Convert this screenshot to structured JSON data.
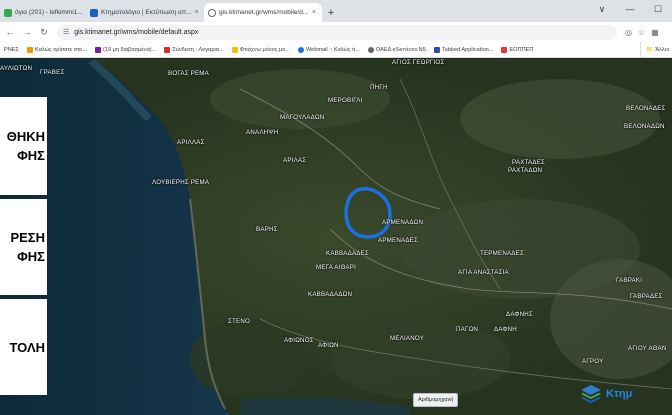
{
  "browser": {
    "tabs": [
      {
        "title": "όγια (201) - lefkimmi1...",
        "close": "×"
      },
      {
        "title": "Κτηματολόγιο | Εκτύπωση απ...",
        "close": "×"
      },
      {
        "title": "gis.ktimanet.gr/wms/mobile/d...",
        "close": "×"
      }
    ],
    "new_tab": "+",
    "window_controls": [
      "∨",
      "—",
      "☐"
    ],
    "url": "gis.ktimanet.gr/wms/mobile/default.aspx",
    "bookmarks": [
      {
        "label": "ΡΝΕΣ",
        "color": "#ffffff"
      },
      {
        "label": "Καλώς ορίσατε στο...",
        "color": "#f29900"
      },
      {
        "label": "(19 μη διαβασμένα)...",
        "color": "#7b1fa2"
      },
      {
        "label": "Σύνδεση - Λογαρια...",
        "color": "#d93025"
      },
      {
        "label": "Φτιάχνω μόνος μο...",
        "color": "#fbbc04"
      },
      {
        "label": "Webmail :: Καλώς ή...",
        "color": "#1a73e8"
      },
      {
        "label": "ΟΑΕΔ eServices Ν5",
        "color": "#5f6368"
      },
      {
        "label": "Tabbed Application...",
        "color": "#3949ab"
      },
      {
        "label": "ΕΟΠΠΕΠ",
        "color": "#e53935"
      }
    ],
    "other_bookmarks": "Άλλοι"
  },
  "side_panels": [
    {
      "lines": [
        "ΘΗΚΗ",
        "ΦΗΣ"
      ]
    },
    {
      "lines": [
        "ΡΕΣΗ",
        "ΦΗΣ"
      ]
    },
    {
      "lines": [
        "ΤΟΛΗ"
      ]
    }
  ],
  "map_labels": [
    "ΑΥΛΙΩΤΩΝ",
    "ΓΡΑΒΕΣ",
    "ΒΟΓΑΣ ΡΕΜΑ",
    "ΑΓΙΟΣ ΓΕΩΡΓΙΟΣ",
    "ΠΗΓΗ",
    "ΜΕΡΟΒΙΓΛΙ",
    "ΜΑΓΟΥΛΑΔΩΝ",
    "ΑΝΑΛΗΨΗ",
    "ΑΡΙΛΛΑΣ",
    "ΑΡΙΛΑΣ",
    "ΛΟΥΒΙΕΡΗΣ ΡΕΜΑ",
    "ΒΕΛΟΝΑΔΕΣ",
    "ΒΕΛΟΝΑΔΩΝ",
    "ΡΑΧΤΑΔΕΣ",
    "ΡΑΧΤΑΔΩΝ",
    "ΑΡΜΕΝΑΔΩΝ",
    "ΑΡΜΕΝΑΔΕΣ",
    "ΒΑΡΗΣ",
    "ΚΑΒΒΑΔΑΔΕΣ",
    "ΜΕΓΑ ΑΙΘΑΡΙ",
    "ΤΕΡΜΕΝΑΔΕΣ",
    "ΑΓΙΑ ΑΝΑΣΤΑΣΙΑ",
    "ΓΑΒΡΑΚΙ",
    "ΓΑΒΡΑΔΕΣ",
    "ΚΑΒΒΑΔΑΔΩΝ",
    "ΣΤΕΝΟ",
    "ΔΑΦΝΗΣ",
    "ΠΑΓΩΝ",
    "ΔΑΦΝΗ",
    "ΑΦΙΩΝΟΣ",
    "ΑΦΙΩΝ",
    "ΜΕΛΙΑΝΟΥ",
    "ΑΓΙΟΥ ΑΘΑΝ",
    "ΑΓΡΟΥ"
  ],
  "measure_button": "Αριθμομηχανή",
  "logo_text": "Κτημ",
  "colors": {
    "highlight_circle": "#1e6fe0",
    "accent": "#1a73e8"
  }
}
